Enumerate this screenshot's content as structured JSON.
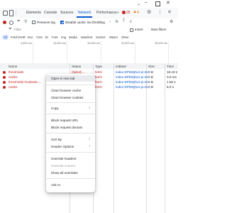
{
  "tabs": [
    {
      "label": "Elements"
    },
    {
      "label": "Console"
    },
    {
      "label": "Sources"
    },
    {
      "label": "Network"
    },
    {
      "label": "Performance"
    }
  ],
  "more_tabs": "»",
  "error_count": "25",
  "warning_count": "4",
  "toolbar": {
    "preserve_log": "Preserve log",
    "disable_cache": "Disable cache",
    "throttling": "No throttling"
  },
  "filter": {
    "placeholder": "Filter",
    "invert": "Invert",
    "more_filters": "More filters"
  },
  "types": [
    "All",
    "Fetch/XHR",
    "Doc",
    "CSS",
    "JS",
    "Font",
    "Img",
    "Media",
    "Manifest",
    "Socket",
    "Wasm",
    "Other"
  ],
  "timeline_ticks": [
    "3,000 ms",
    "10,000 ms",
    "15,000 ms",
    "20,000 ms",
    "25,000 ms"
  ],
  "columns": {
    "name": "Name",
    "status": "Status",
    "type": "Type",
    "initiator": "Initiator",
    "size": "Size",
    "time": "Time"
  },
  "rows": [
    {
      "name": "thresholds",
      "status": "(failed) ...",
      "type": "fetch",
      "initiator": "index-DPk9Qbc2.js:22",
      "size": "0 B",
      "time": "18.19 s"
    },
    {
      "name": "nodes",
      "status": "(failed) ...",
      "type": "fetch",
      "initiator": "index-DPk9Qbc2.js:22",
      "size": "0 B",
      "time": "0.8 ms"
    },
    {
      "name": "thresholds?nodeIds=...",
      "status": "(failed) ...",
      "type": "fetch",
      "initiator": "index-DPk9Qbc2.js:22",
      "size": "0 B",
      "time": "1.56 s"
    },
    {
      "name": "nodes",
      "status": "(failed) ...",
      "type": "fetch",
      "initiator": "index-DPk9Qbc2.js:22",
      "size": "0 B",
      "time": "8.0 s"
    }
  ],
  "menu": {
    "open_new_tab": "Open in new tab",
    "clear_cache": "Clear browser cache",
    "clear_cookies": "Clear browser cookies",
    "copy": "Copy",
    "block_url": "Block request URL",
    "block_domain": "Block request domain",
    "sort_by": "Sort By",
    "header_options": "Header Options",
    "override_headers": "Override headers",
    "override_content": "Override content",
    "show_overrides": "Show all overrides",
    "ask_ai": "Ask AI"
  },
  "colors": {
    "accent": "#0b57d0",
    "error": "#c5221f",
    "warning": "#e37400"
  }
}
